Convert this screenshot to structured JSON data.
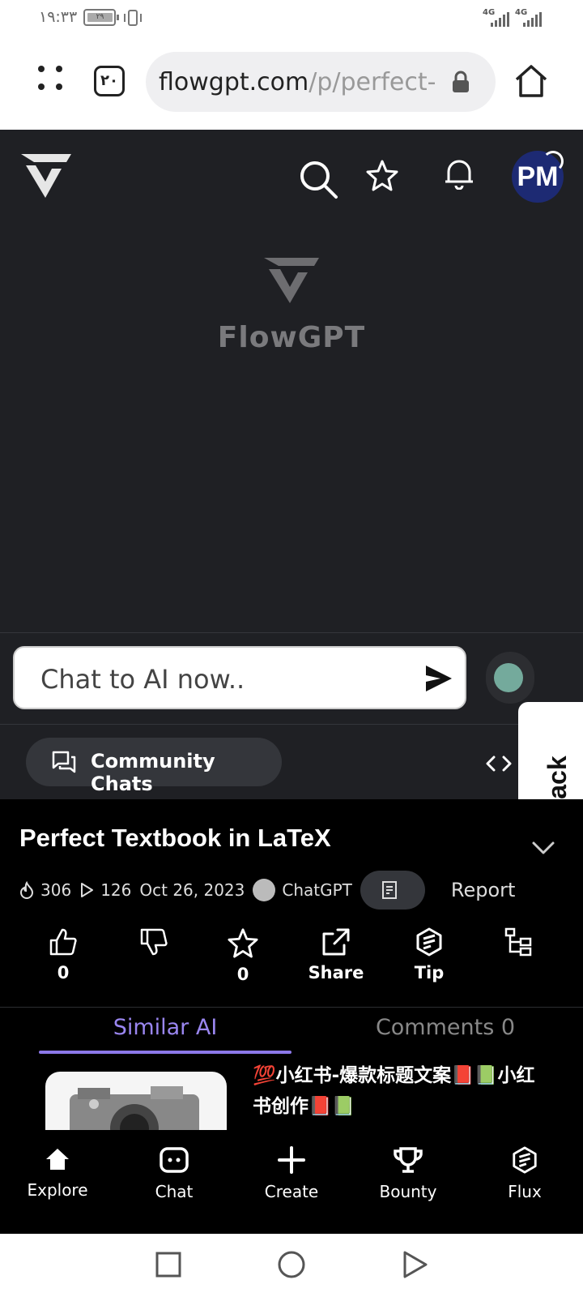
{
  "status_bar": {
    "time": "١٩:٣٣",
    "battery": "٢٩",
    "network_1": "4G",
    "network_2": "4G"
  },
  "browser": {
    "tab_count": "٢٠",
    "url_host": "flowgpt.com",
    "url_path": "/p/perfect-"
  },
  "header": {
    "avatar_initials": "PM",
    "brand_name": "FlowGPT"
  },
  "chat": {
    "placeholder": "Chat to AI now..",
    "community_label": "Community Chats",
    "feedback_label": "Feedback"
  },
  "prompt": {
    "title": "Perfect Textbook in LaTeX",
    "views": "306",
    "plays": "126",
    "date": "Oct 26, 2023",
    "model": "ChatGPT",
    "report_label": "Report"
  },
  "actions": {
    "like_count": "0",
    "favorite_count": "0",
    "share_label": "Share",
    "tip_label": "Tip"
  },
  "tabs": {
    "similar": "Similar AI",
    "comments": "Comments 0"
  },
  "similar_card": {
    "title": "💯小红书-爆款标题文案📕📗小红书创作📕📗"
  },
  "bottom_nav": {
    "explore": "Explore",
    "chat": "Chat",
    "create": "Create",
    "bounty": "Bounty",
    "flux": "Flux"
  },
  "colors": {
    "app_bg": "#1f2024",
    "accent": "#9a86f0",
    "avatar_bg": "#1d2a73"
  }
}
